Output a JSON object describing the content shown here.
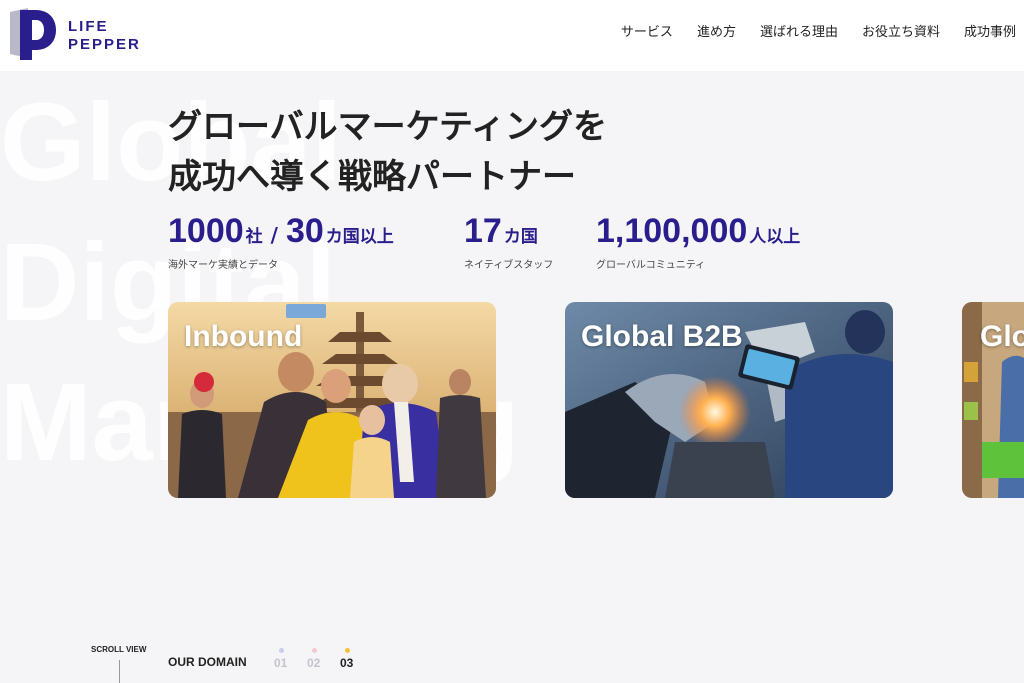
{
  "header": {
    "logo_line1": "LIFE",
    "logo_line2": "PEPPER",
    "nav": [
      "サービス",
      "進め方",
      "選ばれる理由",
      "お役立ち資料",
      "成功事例"
    ]
  },
  "background_words": [
    "Global",
    "Digital",
    "Marketing"
  ],
  "hero": {
    "headline_line1": "グローバルマーケティングを",
    "headline_line2": "成功へ導く戦略パートナー"
  },
  "stats": [
    {
      "num1": "1000",
      "unit1": "社",
      "sep": "/",
      "num2": "30",
      "unit2": "カ国以上",
      "caption": "海外マーケ実績とデータ"
    },
    {
      "num1": "17",
      "unit1": "カ国",
      "caption": "ネイティブスタッフ"
    },
    {
      "num1": "1,100,000",
      "unit1": "人以上",
      "caption": "グローバルコミュニティ"
    }
  ],
  "cards": [
    {
      "title": "Inbound"
    },
    {
      "title": "Global B2B"
    },
    {
      "title": "Glo"
    }
  ],
  "footer": {
    "scroll_label": "SCROLL VIEW",
    "domain_label": "OUR DOMAIN",
    "pages": [
      "01",
      "02",
      "03"
    ],
    "active_page": "03"
  },
  "colors": {
    "brand": "#2a1e8c",
    "background": "#f5f5f7",
    "dot_01": "#c9cdf0",
    "dot_02": "#f3c9d0",
    "dot_03": "#f2c23a"
  }
}
